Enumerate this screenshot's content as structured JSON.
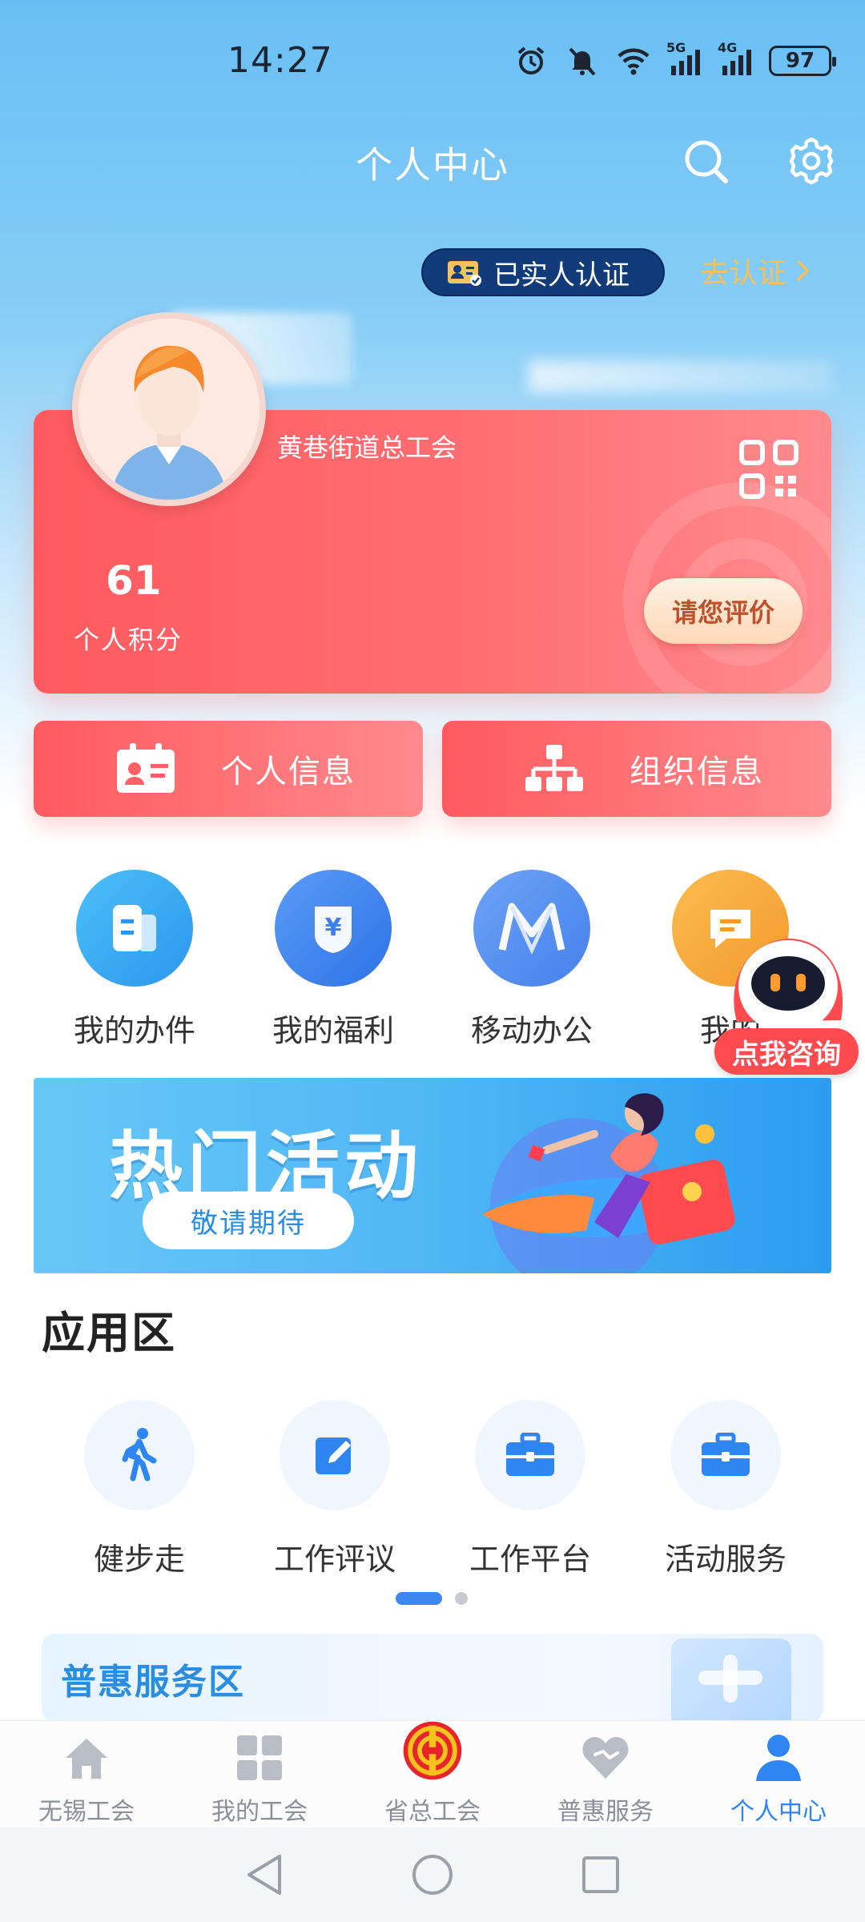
{
  "status_bar": {
    "time": "14:27",
    "signal1_label": "5G",
    "signal2_label": "4G",
    "battery": "97"
  },
  "nav": {
    "title": "个人中心",
    "search_icon": "search-icon",
    "settings_icon": "gear-icon"
  },
  "verification": {
    "badge_label": "已实人认证",
    "link_label": "去认证"
  },
  "profile": {
    "org_name": "黄巷街道总工会",
    "points_value": "61",
    "points_label": "个人积分",
    "rate_button": "请您评价"
  },
  "info_buttons": [
    {
      "label": "个人信息",
      "icon": "id-card-icon"
    },
    {
      "label": "组织信息",
      "icon": "org-chart-icon"
    }
  ],
  "quick_entries": [
    {
      "label": "我的办件",
      "icon": "document-icon",
      "color": "#3aa9f4"
    },
    {
      "label": "我的福利",
      "icon": "yuan-icon",
      "color": "#3d86f0"
    },
    {
      "label": "移动办公",
      "icon": "m-logo-icon",
      "color": "#4d8ff2"
    },
    {
      "label": "我的",
      "icon": "message-icon",
      "color": "#f7a33a"
    }
  ],
  "consult": {
    "label": "点我咨询"
  },
  "banner": {
    "title": "热门活动",
    "pill": "敬请期待"
  },
  "apps": {
    "section_title": "应用区",
    "items": [
      {
        "label": "健步走",
        "icon": "walking-icon"
      },
      {
        "label": "工作评议",
        "icon": "edit-icon"
      },
      {
        "label": "工作平台",
        "icon": "briefcase-icon"
      },
      {
        "label": "活动服务",
        "icon": "briefcase-icon"
      }
    ],
    "pager_pages": 2,
    "pager_active": 1
  },
  "benefit": {
    "title": "普惠服务区"
  },
  "tab_bar": {
    "items": [
      {
        "label": "无锡工会",
        "icon": "home-icon",
        "active": false
      },
      {
        "label": "我的工会",
        "icon": "grid-icon",
        "active": false
      },
      {
        "label": "省总工会",
        "icon": "union-emblem-icon",
        "active": false
      },
      {
        "label": "普惠服务",
        "icon": "heart-icon",
        "active": false
      },
      {
        "label": "个人中心",
        "icon": "person-icon",
        "active": true
      }
    ]
  },
  "colors": {
    "accent_blue": "#2f86f2",
    "card_red": "#ff5a5f",
    "verify_gold": "#f6c15a"
  }
}
